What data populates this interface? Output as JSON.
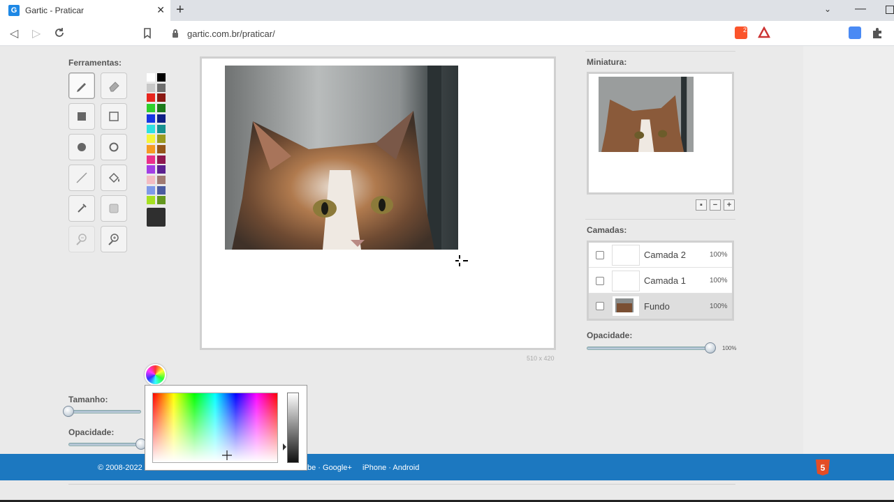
{
  "browser": {
    "tab_title": "Gartic - Praticar",
    "favicon_letter": "G",
    "url": "gartic.com.br/praticar/",
    "brave_badge": "2"
  },
  "tools": {
    "heading": "Ferramentas:",
    "items": [
      {
        "name": "pencil-tool",
        "icon": "pencil-icon",
        "active": true
      },
      {
        "name": "eraser-tool",
        "icon": "eraser-icon"
      },
      {
        "name": "filled-rectangle-tool",
        "icon": "filled-square-icon"
      },
      {
        "name": "rectangle-outline-tool",
        "icon": "square-outline-icon"
      },
      {
        "name": "filled-ellipse-tool",
        "icon": "filled-circle-icon"
      },
      {
        "name": "ellipse-outline-tool",
        "icon": "circle-outline-icon"
      },
      {
        "name": "line-tool",
        "icon": "line-icon"
      },
      {
        "name": "fill-bucket-tool",
        "icon": "paint-bucket-icon"
      },
      {
        "name": "eyedropper-tool",
        "icon": "eyedropper-icon"
      },
      {
        "name": "stamp-tool",
        "icon": "stamp-icon"
      },
      {
        "name": "zoom-out-tool",
        "icon": "zoom-out-icon",
        "disabled": true
      },
      {
        "name": "zoom-in-tool",
        "icon": "zoom-in-icon"
      }
    ]
  },
  "palette": {
    "colors": [
      [
        "#ffffff",
        "#000000"
      ],
      [
        "#c8c8c8",
        "#6e6e6e"
      ],
      [
        "#e8261e",
        "#8b1a14"
      ],
      [
        "#2ed02c",
        "#1d7a1b"
      ],
      [
        "#1736e3",
        "#0f1f84"
      ],
      [
        "#2fe0e0",
        "#179090"
      ],
      [
        "#f5f53a",
        "#9a9a20"
      ],
      [
        "#f59a23",
        "#94561b"
      ],
      [
        "#ea2f8b",
        "#8e1850"
      ],
      [
        "#a23fe5",
        "#5b2190"
      ],
      [
        "#f3bcc3",
        "#a07a72"
      ],
      [
        "#7f9ae8",
        "#4b5ba0"
      ],
      [
        "#a6e022",
        "#64971f"
      ]
    ],
    "selected_color": "#2f2f2f"
  },
  "canvas": {
    "size_label": "510 x 420"
  },
  "miniature": {
    "heading": "Miniatura:",
    "zoom_buttons": [
      "▪",
      "−",
      "+"
    ]
  },
  "layers": {
    "heading": "Camadas:",
    "items": [
      {
        "name": "Camada 2",
        "opacity": "100%",
        "has_image": false,
        "selected": false
      },
      {
        "name": "Camada 1",
        "opacity": "100%",
        "has_image": false,
        "selected": false
      },
      {
        "name": "Fundo",
        "opacity": "100%",
        "has_image": true,
        "selected": true
      }
    ],
    "opacity_label": "Opacidade:",
    "opacity_value": "100%",
    "opacity_fraction": 1.0
  },
  "brush": {
    "size_label": "Tamanho:",
    "size_fraction": 0.0,
    "opacity_label": "Opacidade:",
    "opacity_fraction": 1.0
  },
  "footer": {
    "copyright": "© 2008-2022",
    "links_partial": "be · Google+",
    "links_right": "iPhone · Android",
    "html5_label": "5"
  }
}
